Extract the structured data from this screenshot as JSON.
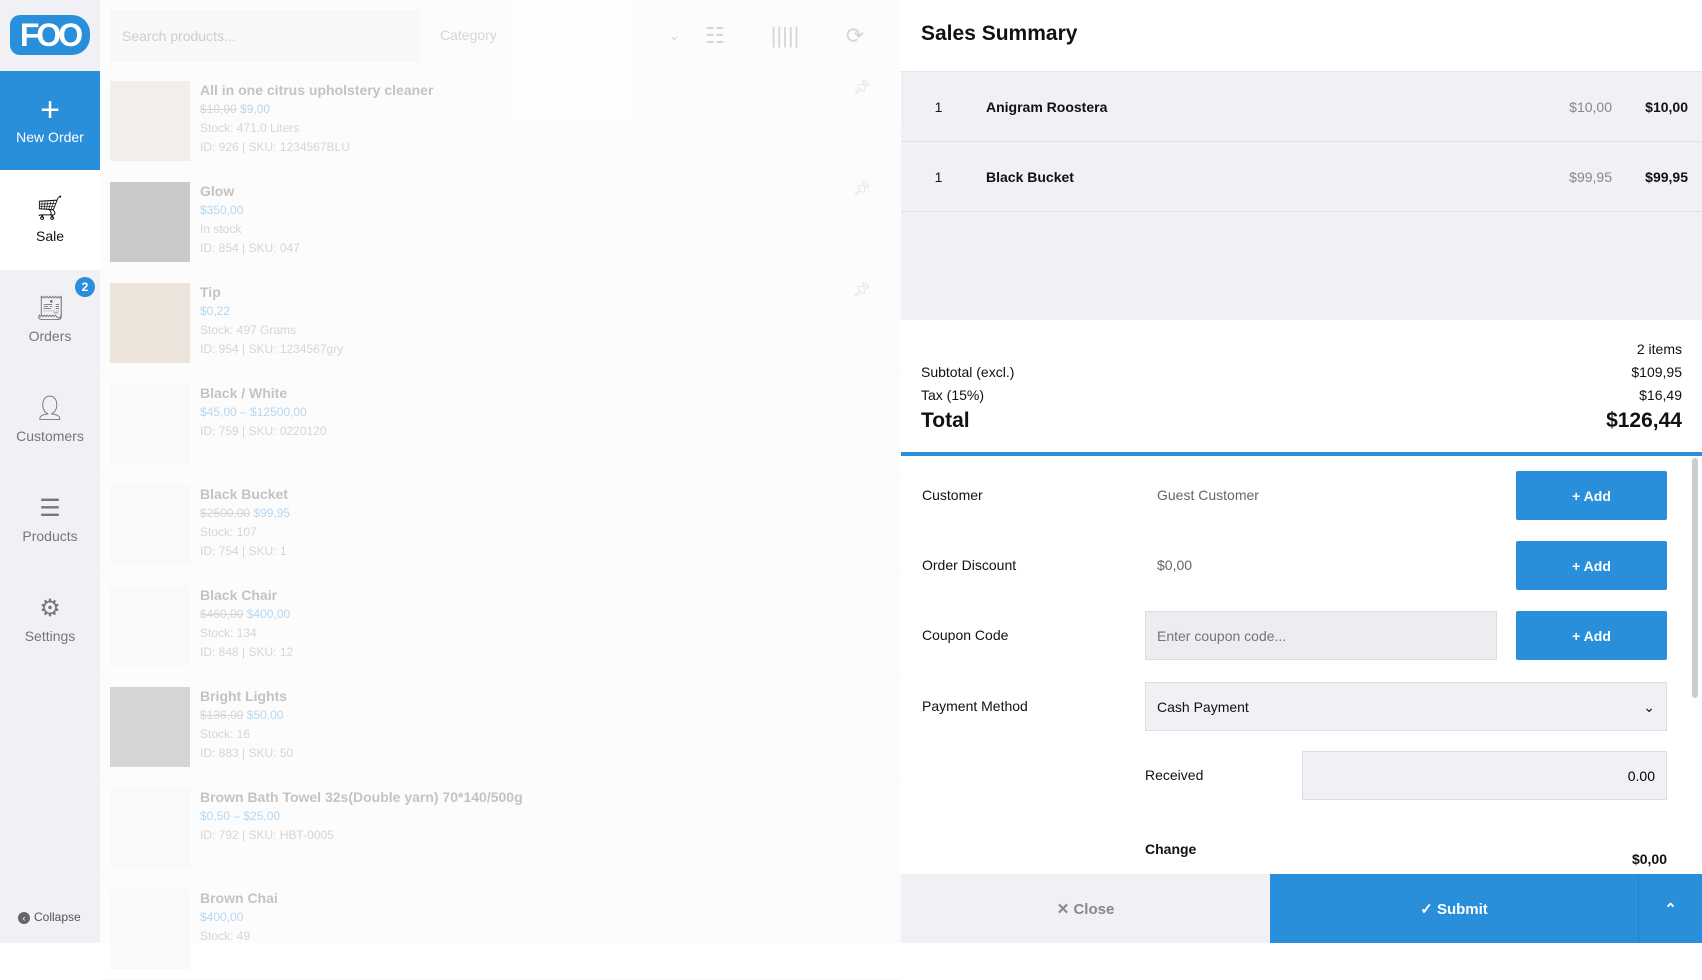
{
  "sidebar": {
    "logo": "FOO",
    "new_order": "New Order",
    "items": [
      {
        "label": "Sale"
      },
      {
        "label": "Orders",
        "badge": "2"
      },
      {
        "label": "Customers"
      },
      {
        "label": "Products"
      },
      {
        "label": "Settings"
      }
    ],
    "collapse": "Collapse"
  },
  "toolbar": {
    "search_placeholder": "Search products...",
    "category": "Category"
  },
  "products": [
    {
      "name": "All in one citrus upholstery cleaner",
      "old_price": "$10,00",
      "price": "$9,00",
      "stock": "Stock: 471.0 Liters",
      "meta": "ID: 926 | SKU: 1234567BLU"
    },
    {
      "name": "Glow",
      "old_price": "",
      "price": "$350,00",
      "stock": "In stock",
      "meta": "ID: 854 | SKU: 047"
    },
    {
      "name": "Tip",
      "old_price": "",
      "price": "$0,22",
      "stock": "Stock: 497 Grams",
      "meta": "ID: 954 | SKU: 1234567gry"
    },
    {
      "name": "Black / White",
      "old_price": "",
      "price": "$45,00 – $12500,00",
      "stock": "",
      "meta": "ID: 759 | SKU: 0220120"
    },
    {
      "name": "Black Bucket",
      "old_price": "$2500,00",
      "price": "$99,95",
      "stock": "Stock: 107",
      "meta": "ID: 754 | SKU: 1"
    },
    {
      "name": "Black Chair",
      "old_price": "$460,00",
      "price": "$400,00",
      "stock": "Stock: 134",
      "meta": "ID: 848 | SKU: 12"
    },
    {
      "name": "Bright Lights",
      "old_price": "$136,00",
      "price": "$50,00",
      "stock": "Stock: 16",
      "meta": "ID: 883 | SKU: 50"
    },
    {
      "name": "Brown Bath Towel 32s(Double yarn) 70*140/500g",
      "old_price": "",
      "price": "$0,50 – $25,00",
      "stock": "",
      "meta": "ID: 792 | SKU: HBT-0005"
    },
    {
      "name": "Brown Chai",
      "old_price": "",
      "price": "$400,00",
      "stock": "Stock: 49",
      "meta": ""
    }
  ],
  "summary": {
    "title": "Sales Summary",
    "cart": [
      {
        "qty": "1",
        "name": "Anigram Roostera",
        "unit": "$10,00",
        "total": "$10,00"
      },
      {
        "qty": "1",
        "name": "Black Bucket",
        "unit": "$99,95",
        "total": "$99,95"
      }
    ],
    "items_count": "2 items",
    "subtotal_label": "Subtotal (excl.)",
    "subtotal": "$109,95",
    "tax_label": "Tax (15%)",
    "tax": "$16,49",
    "total_label": "Total",
    "total": "$126,44"
  },
  "form": {
    "customer_label": "Customer",
    "customer": "Guest Customer",
    "discount_label": "Order Discount",
    "discount": "$0,00",
    "coupon_label": "Coupon Code",
    "coupon_placeholder": "Enter coupon code...",
    "payment_label": "Payment Method",
    "payment": "Cash Payment",
    "received_label": "Received",
    "received": "0.00",
    "change_label": "Change",
    "change": "$0,00",
    "add": "+ Add"
  },
  "footer": {
    "close": "✕  Close",
    "submit": "✓ Submit"
  }
}
